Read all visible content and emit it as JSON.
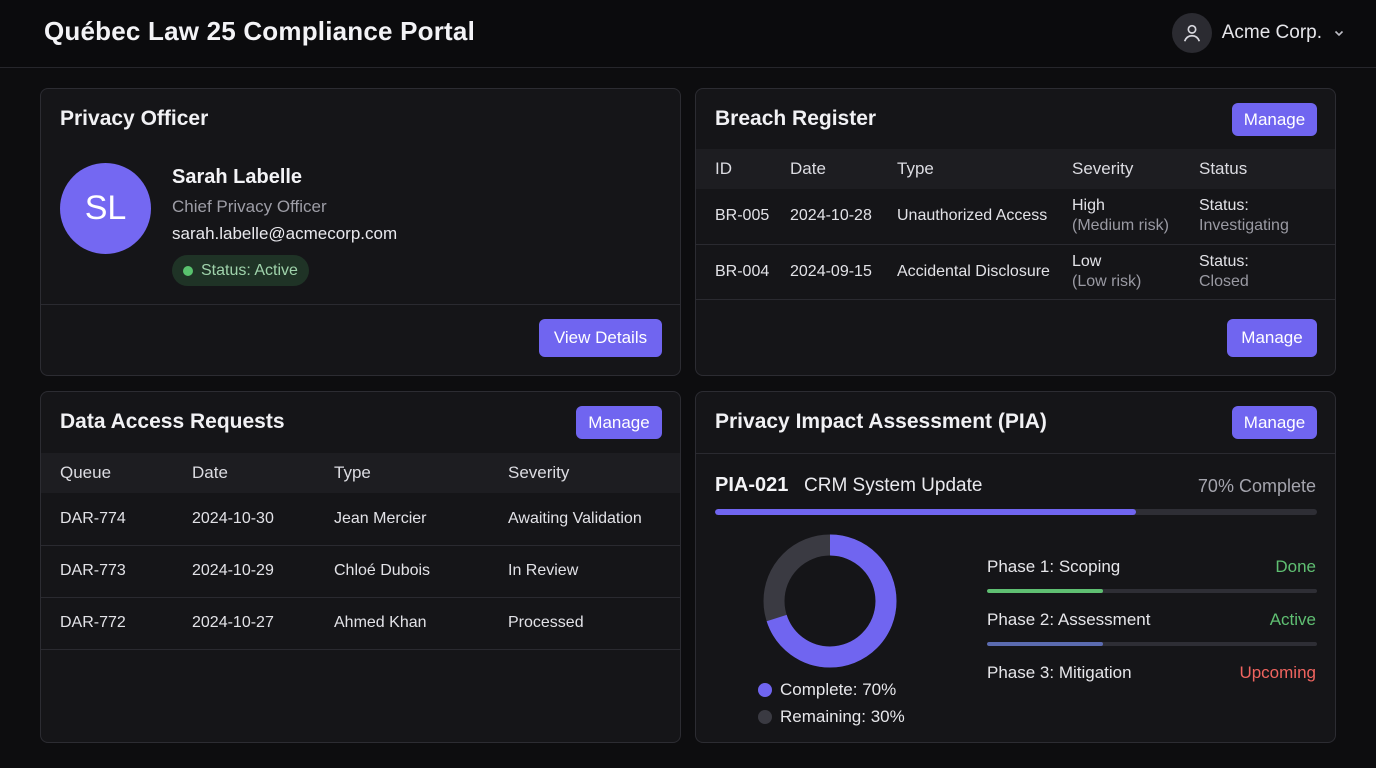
{
  "app": {
    "title": "Québec Law 25 Compliance Portal"
  },
  "account": {
    "name": "Acme Corp.",
    "avatar_icon": "user-icon"
  },
  "officer": {
    "title": "Privacy Officer",
    "initials": "SL",
    "name": "Sarah Labelle",
    "role": "Chief Privacy Officer",
    "email": "sarah.labelle@acmecorp.com",
    "status": "Status: Active",
    "button": "View Details"
  },
  "breach": {
    "title": "Breach Register",
    "manage_top": "Manage",
    "manage_bottom": "Manage",
    "columns": [
      "ID",
      "Date",
      "Type",
      "Severity",
      "Status"
    ],
    "rows": [
      {
        "id": "BR-005",
        "date": "2024-10-28",
        "type": "Unauthorized Access",
        "severity": "High",
        "severity_note": "(Medium risk)",
        "status_label": "Status:",
        "status": "Investigating"
      },
      {
        "id": "BR-004",
        "date": "2024-09-15",
        "type": "Accidental Disclosure",
        "severity": "Low",
        "severity_note": "(Low risk)",
        "status_label": "Status:",
        "status": "Closed"
      }
    ]
  },
  "dar": {
    "title": "Data Access Requests",
    "manage": "Manage",
    "columns": [
      "Queue",
      "Date",
      "Type",
      "Severity"
    ],
    "rows": [
      {
        "queue": "DAR-774",
        "date": "2024-10-30",
        "type": "Jean Mercier",
        "severity": "Awaiting Validation"
      },
      {
        "queue": "DAR-773",
        "date": "2024-10-29",
        "type": "Chloé Dubois",
        "severity": "In Review"
      },
      {
        "queue": "DAR-772",
        "date": "2024-10-27",
        "type": "Ahmed Khan",
        "severity": "Processed"
      }
    ]
  },
  "pia": {
    "title": "Privacy Impact Assessment (PIA)",
    "manage": "Manage",
    "id": "PIA-021",
    "name": "CRM System Update",
    "progress_label": "70% Complete",
    "progress": 0.7,
    "legend": {
      "complete": "Complete: 70%",
      "remaining": "Remaining: 30%"
    },
    "phases": [
      {
        "name": "Phase 1: Scoping",
        "state": "Done",
        "progress": 0.35,
        "color": "#5fbf72"
      },
      {
        "name": "Phase 2: Assessment",
        "state": "Active",
        "progress": 0.35,
        "color": "#5fbf72"
      },
      {
        "name": "Phase 3: Mitigation",
        "state": "Upcoming",
        "progress": 0,
        "color": "#f0645f"
      }
    ]
  },
  "colors": {
    "accent": "#7065f0",
    "success": "#5fbf72",
    "warning": "#f0645f",
    "remaining": "#3a3a42"
  }
}
